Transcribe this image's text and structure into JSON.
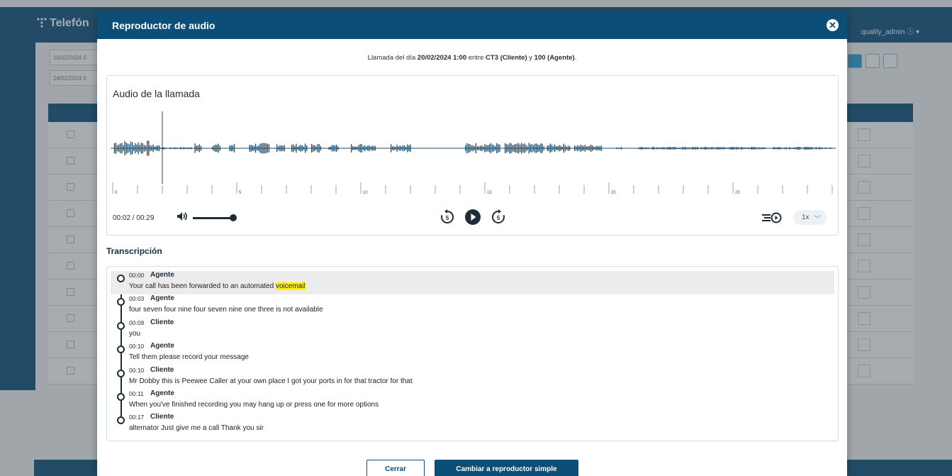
{
  "background": {
    "app_name": "Telefón",
    "user": "quality_admin",
    "filter_1": "16/02/2024 0",
    "filter_2": "24/02/2024 0"
  },
  "modal": {
    "title": "Reproductor de audio",
    "call_info": {
      "prefix": "Llamada del día",
      "datetime": "20/02/2024 1:00",
      "between": "entre",
      "caller": "CT3 (Cliente)",
      "and": "y",
      "agent": "100 (Agente)",
      "suffix": "."
    },
    "audio": {
      "title": "Audio de la llamada",
      "current_time": "00:02 / 00:29",
      "playhead_seconds": 2,
      "duration_seconds": 29,
      "timeline_labels": [
        "0",
        "5",
        "10",
        "15",
        "20",
        "25"
      ],
      "volume_level": 1.0,
      "speed": "1x"
    },
    "transcription": {
      "title": "Transcripción",
      "entries": [
        {
          "time": "00:00",
          "speaker": "Agente",
          "text_before": "Your call has been forwarded to an automated ",
          "highlight": "voicemail",
          "active": true
        },
        {
          "time": "00:03",
          "speaker": "Agente",
          "text_before": "four seven four nine four seven nine one three is not available",
          "highlight": ""
        },
        {
          "time": "00:09",
          "speaker": "Cliente",
          "text_before": "you",
          "highlight": ""
        },
        {
          "time": "00:10",
          "speaker": "Agente",
          "text_before": "Tell them please record your message",
          "highlight": ""
        },
        {
          "time": "00:10",
          "speaker": "Cliente",
          "text_before": "Mr Dobby this is Peewee Caller at your own place I got your ports in for that tractor for that",
          "highlight": ""
        },
        {
          "time": "00:11",
          "speaker": "Agente",
          "text_before": "When you've finished recording you may hang up or press one for more options",
          "highlight": ""
        },
        {
          "time": "00:17",
          "speaker": "Cliente",
          "text_before": "alternator Just give me a call Thank you sir",
          "highlight": ""
        }
      ]
    },
    "buttons": {
      "close": "Cerrar",
      "switch": "Cambiar a reproductor simple"
    }
  },
  "colors": {
    "primary": "#0b4f79",
    "dark": "#1e2d3a",
    "highlight": "#fff200",
    "accent": "#2b9fd6"
  }
}
